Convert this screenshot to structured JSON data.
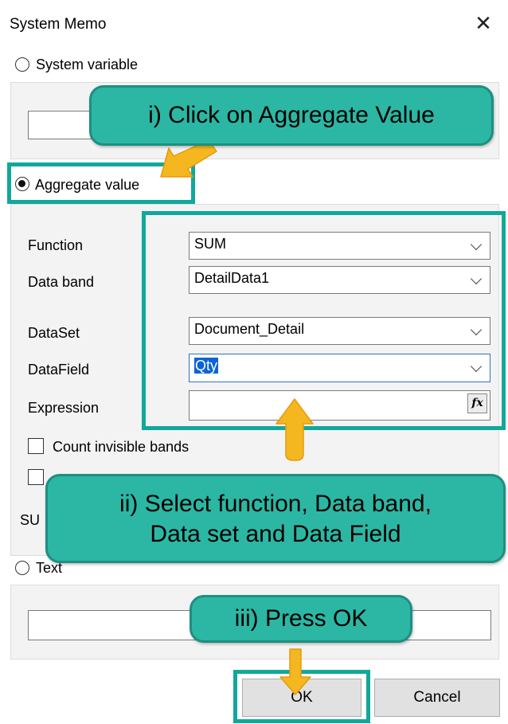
{
  "dialog": {
    "title": "System Memo",
    "close_glyph": "✕"
  },
  "system_variable": {
    "label": "System variable",
    "value": ""
  },
  "aggregate": {
    "label": "Aggregate value",
    "function": {
      "label": "Function",
      "value": "SUM"
    },
    "data_band": {
      "label": "Data band",
      "value": "DetailData1"
    },
    "dataset": {
      "label": "DataSet",
      "value": "Document_Detail"
    },
    "datafield": {
      "label": "DataField",
      "value": "Qty"
    },
    "expression": {
      "label": "Expression",
      "value": "",
      "fx_label": "fx"
    },
    "count_invisible": {
      "label": "Count invisible bands",
      "checked": false
    },
    "second_checkbox": {
      "label": "",
      "checked": false
    },
    "partial_label": "SU"
  },
  "text_option": {
    "label": "Text",
    "value": ""
  },
  "buttons": {
    "ok": "OK",
    "cancel": "Cancel"
  },
  "annotations": {
    "step1": "i) Click on Aggregate Value",
    "step2_line1": "ii) Select function, Data band,",
    "step2_line2": "Data set and Data Field",
    "step3": "iii) Press OK"
  },
  "colors": {
    "callout": "#2bb7a4",
    "highlight": "#11a89a",
    "arrow": "#f4b71f",
    "selection": "#0a64d6"
  }
}
